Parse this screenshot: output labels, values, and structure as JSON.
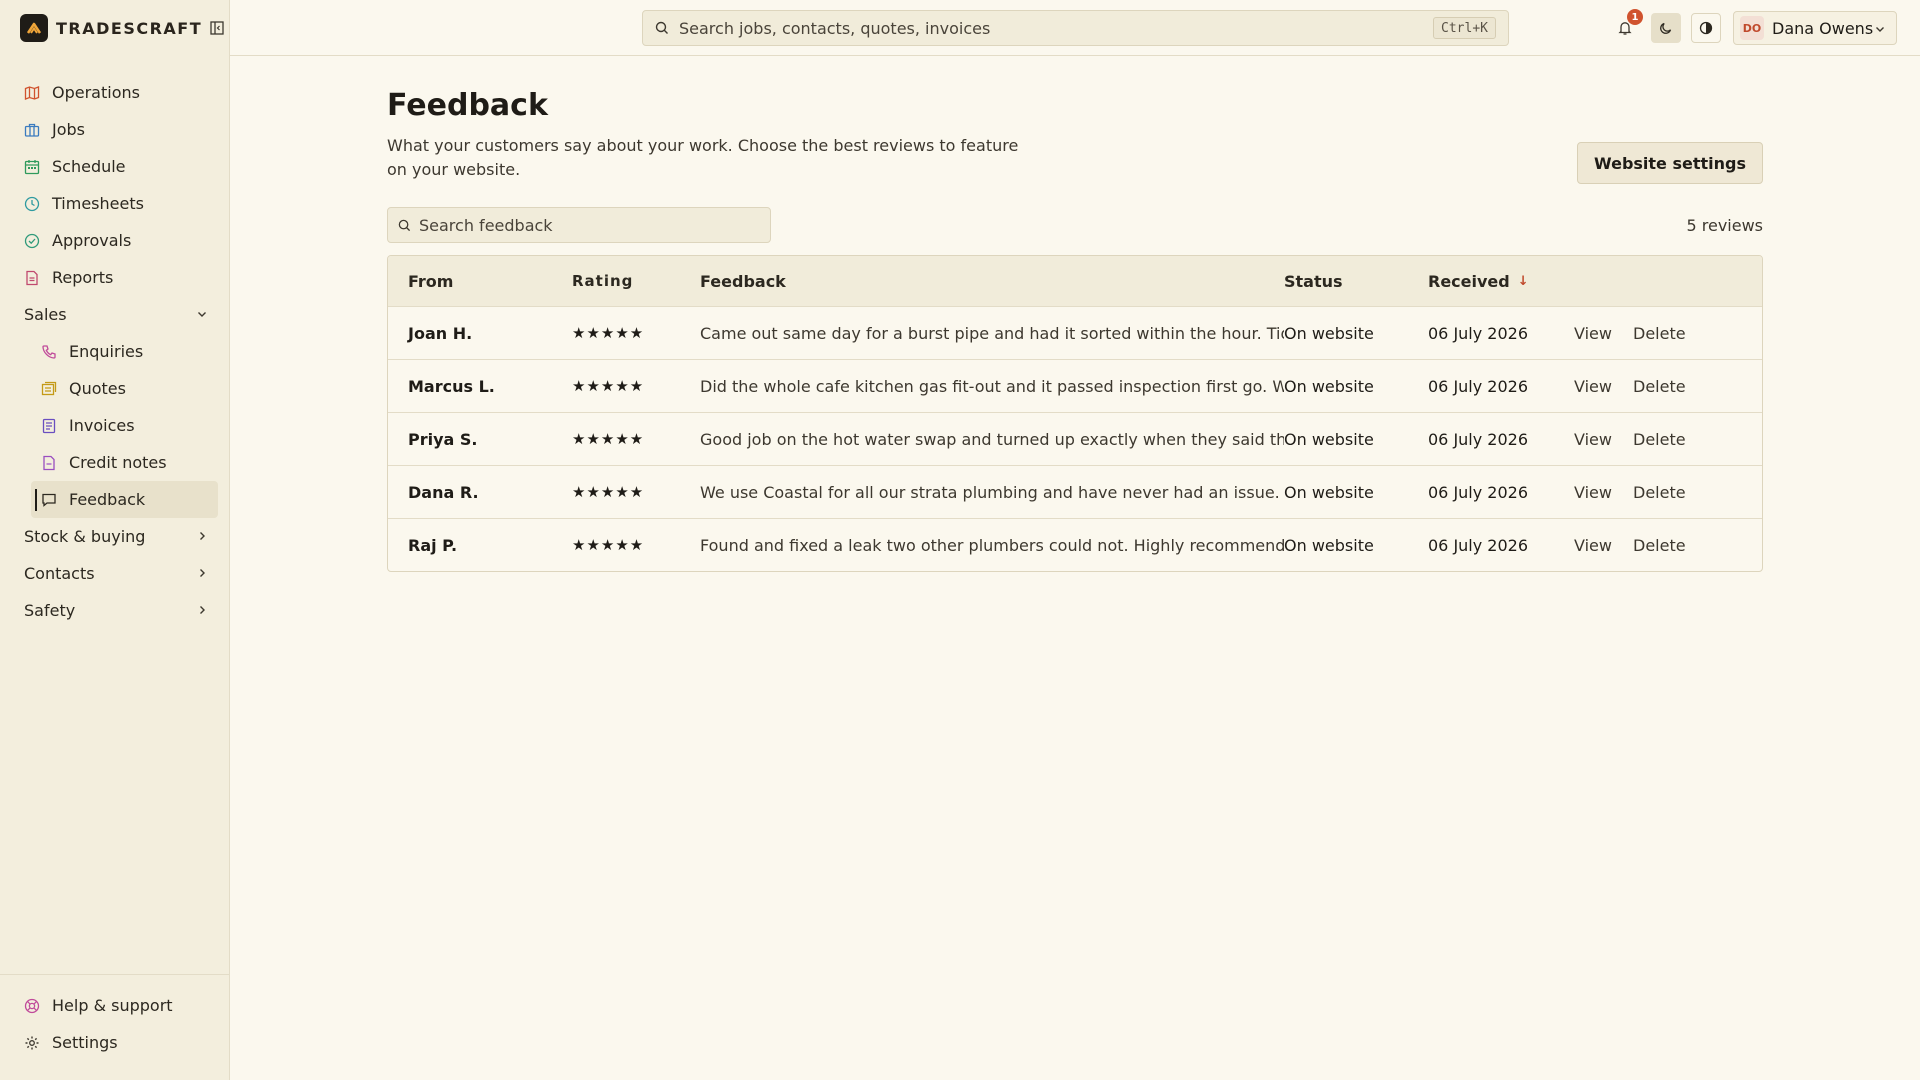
{
  "app": {
    "brand": "TRADESCRAFT"
  },
  "topbar": {
    "search_placeholder": "Search jobs, contacts, quotes, invoices",
    "search_shortcut": "Ctrl+K",
    "notification_count": "1",
    "user_initials": "DO",
    "user_name": "Dana Owens"
  },
  "sidebar": {
    "items": [
      {
        "label": "Operations",
        "icon": "map-icon"
      },
      {
        "label": "Jobs",
        "icon": "briefcase-icon"
      },
      {
        "label": "Schedule",
        "icon": "calendar-icon"
      },
      {
        "label": "Timesheets",
        "icon": "clock-icon"
      },
      {
        "label": "Approvals",
        "icon": "check-circle-icon"
      },
      {
        "label": "Reports",
        "icon": "report-icon"
      }
    ],
    "sales_label": "Sales",
    "sales_items": [
      {
        "label": "Enquiries",
        "icon": "phone-icon"
      },
      {
        "label": "Quotes",
        "icon": "quote-icon"
      },
      {
        "label": "Invoices",
        "icon": "invoice-icon"
      },
      {
        "label": "Credit notes",
        "icon": "credit-note-icon"
      },
      {
        "label": "Feedback",
        "icon": "message-icon"
      }
    ],
    "sections": [
      {
        "label": "Stock & buying"
      },
      {
        "label": "Contacts"
      },
      {
        "label": "Safety"
      }
    ],
    "footer": [
      {
        "label": "Help & support",
        "icon": "help-icon"
      },
      {
        "label": "Settings",
        "icon": "gear-icon"
      }
    ]
  },
  "page": {
    "title": "Feedback",
    "description": "What your customers say about your work. Choose the best reviews to feature on your website.",
    "website_button": "Website settings",
    "search_placeholder": "Search feedback",
    "count": "5 reviews"
  },
  "table": {
    "headers": {
      "from": "From",
      "rating": "Rating",
      "feedback": "Feedback",
      "status": "Status",
      "received": "Received"
    },
    "rows": [
      {
        "from": "Joan H.",
        "rating": "★★★★★",
        "feedback": "Came out same day for a burst pipe and had it sorted within the hour. Tidy, polite and",
        "status": "On website",
        "received": "06 July 2026",
        "view": "View",
        "delete": "Delete"
      },
      {
        "from": "Marcus L.",
        "rating": "★★★★★",
        "feedback": "Did the whole cafe kitchen gas fit-out and it passed inspection first go. Would use",
        "status": "On website",
        "received": "06 July 2026",
        "view": "View",
        "delete": "Delete"
      },
      {
        "from": "Priya S.",
        "rating": "★★★★★",
        "feedback": "Good job on the hot water swap and turned up exactly when they said they would",
        "status": "On website",
        "received": "06 July 2026",
        "view": "View",
        "delete": "Delete"
      },
      {
        "from": "Dana R.",
        "rating": "★★★★★",
        "feedback": "We use Coastal for all our strata plumbing and have never had an issue.",
        "status": "On website",
        "received": "06 July 2026",
        "view": "View",
        "delete": "Delete"
      },
      {
        "from": "Raj P.",
        "rating": "★★★★★",
        "feedback": "Found and fixed a leak two other plumbers could not. Highly recommend.",
        "status": "On website",
        "received": "06 July 2026",
        "view": "View",
        "delete": "Delete"
      }
    ]
  },
  "colors": {
    "accent": "#c0492c",
    "background": "#fbf8ee",
    "sidebar": "#f3eedd"
  }
}
